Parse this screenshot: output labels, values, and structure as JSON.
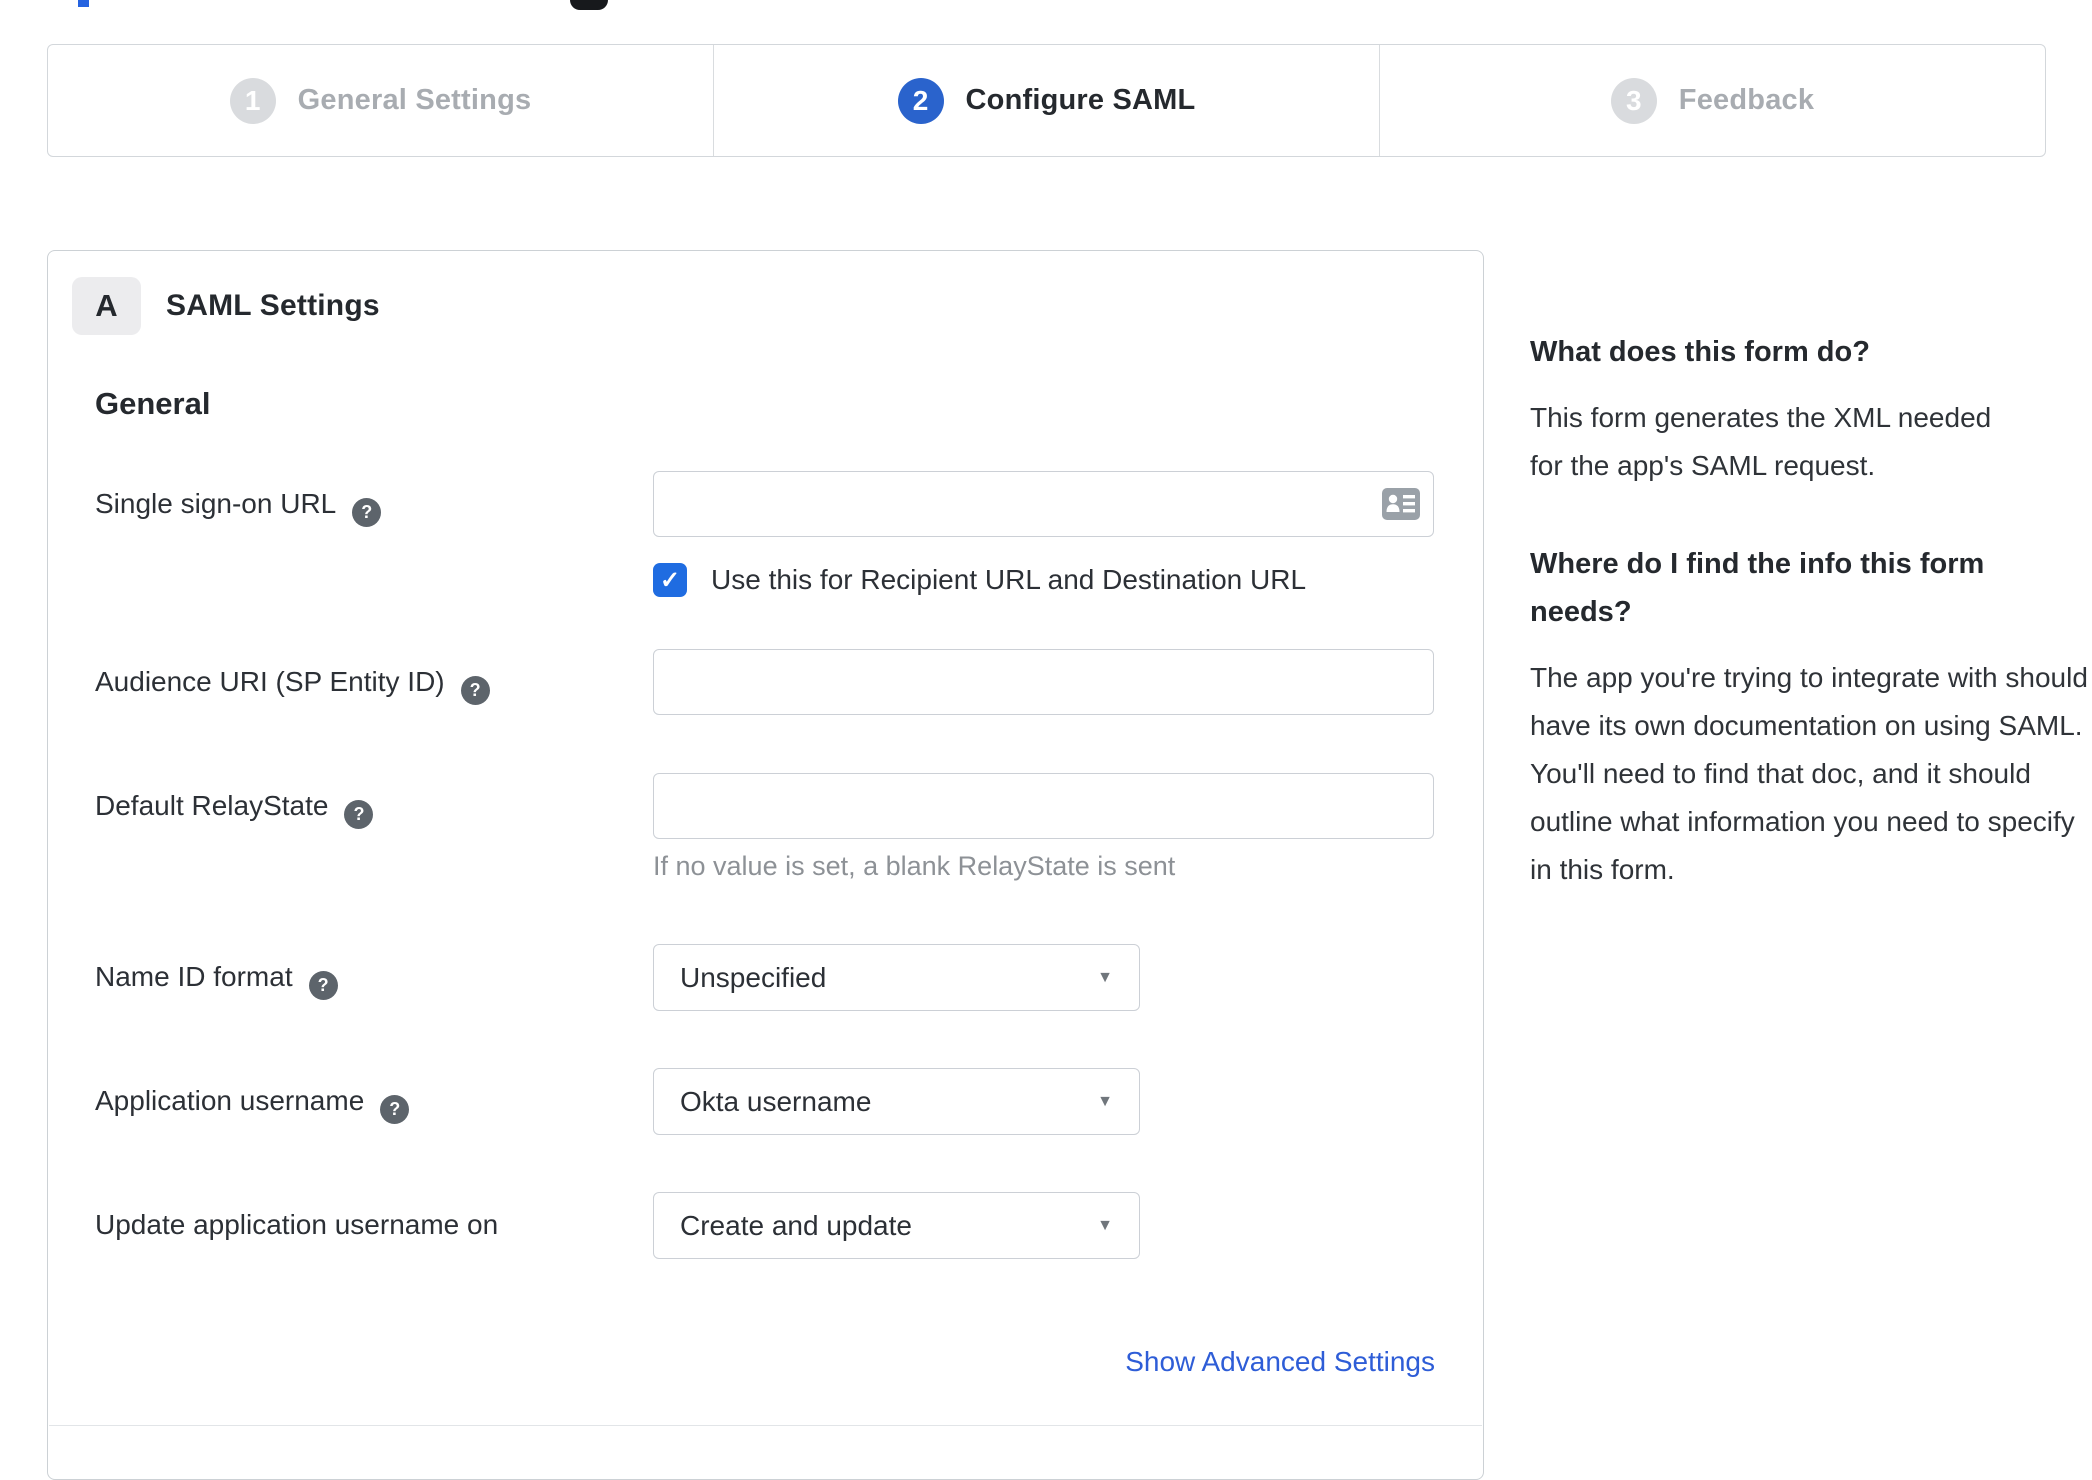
{
  "colors": {
    "step_active_blue": "#2a63cc",
    "checkbox_blue": "#1f6ce1",
    "link_blue": "#2e5dd7"
  },
  "stepper": {
    "steps": [
      {
        "number": "1",
        "label": "General Settings"
      },
      {
        "number": "2",
        "label": "Configure SAML"
      },
      {
        "number": "3",
        "label": "Feedback"
      }
    ],
    "active_step": "Configure SAML"
  },
  "panel": {
    "badge": "A",
    "title": "SAML Settings",
    "section": "General"
  },
  "form": {
    "sso": {
      "label": "Single sign-on URL",
      "value": "",
      "checkbox_label": "Use this for Recipient URL and Destination URL",
      "checkbox_checked": true
    },
    "audience": {
      "label": "Audience URI (SP Entity ID)",
      "value": ""
    },
    "relay": {
      "label": "Default RelayState",
      "value": "",
      "hint": "If no value is set, a blank RelayState is sent"
    },
    "name_id": {
      "label": "Name ID format",
      "value": "Unspecified"
    },
    "app_username": {
      "label": "Application username",
      "value": "Okta username"
    },
    "update_username": {
      "label": "Update application username on",
      "value": "Create and update"
    },
    "advanced_link": "Show Advanced Settings"
  },
  "help_panel": {
    "q1": "What does this form do?",
    "a1": "This form generates the XML needed for the app's SAML request.",
    "q2": "Where do I find the info this form needs?",
    "a2": "The app you're trying to integrate with should have its own documentation on using SAML. You'll need to find that doc, and it should outline what information you need to specify in this form."
  },
  "icons": {
    "help": "?",
    "check": "✓",
    "caret": "▼"
  }
}
